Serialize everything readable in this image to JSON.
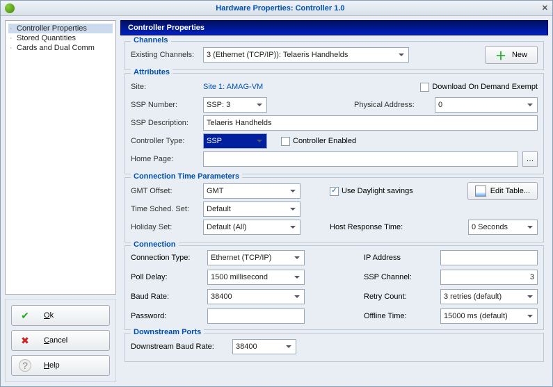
{
  "window_title": "Hardware Properties: Controller 1.0",
  "tree": {
    "items": [
      "Controller Properties",
      "Stored Quantities",
      "Cards and Dual Comm"
    ],
    "selected_index": 0
  },
  "buttons": {
    "ok": "Ok",
    "cancel": "Cancel",
    "help": "Help"
  },
  "header": "Controller Properties",
  "channels": {
    "legend": "Channels",
    "existing_label": "Existing Channels:",
    "existing_value": "3 (Ethernet (TCP/IP)): Telaeris Handhelds",
    "new_label": "New"
  },
  "attributes": {
    "legend": "Attributes",
    "site_label": "Site:",
    "site_value": "Site 1: AMAG-VM",
    "download_exempt_label": "Download On Demand Exempt",
    "download_exempt_checked": false,
    "ssp_number_label": "SSP Number:",
    "ssp_number_value": "SSP: 3",
    "physical_address_label": "Physical Address:",
    "physical_address_value": "0",
    "ssp_description_label": "SSP Description:",
    "ssp_description_value": "Telaeris Handhelds",
    "controller_type_label": "Controller Type:",
    "controller_type_value": "SSP",
    "controller_enabled_label": "Controller Enabled",
    "controller_enabled_checked": false,
    "home_page_label": "Home Page:",
    "home_page_value": ""
  },
  "conn_time": {
    "legend": "Connection Time Parameters",
    "gmt_offset_label": "GMT Offset:",
    "gmt_offset_value": "GMT",
    "daylight_label": "Use Daylight savings",
    "daylight_checked": true,
    "edit_table_label": "Edit Table...",
    "time_sched_label": "Time Sched. Set:",
    "time_sched_value": "Default",
    "holiday_label": "Holiday Set:",
    "holiday_value": "Default (All)",
    "host_response_label": "Host Response Time:",
    "host_response_value": "0 Seconds"
  },
  "connection": {
    "legend": "Connection",
    "type_label": "Connection Type:",
    "type_value": "Ethernet (TCP/IP)",
    "ip_label": "IP Address",
    "ip_value": "",
    "poll_label": "Poll Delay:",
    "poll_value": "1500 millisecond",
    "ssp_channel_label": "SSP Channel:",
    "ssp_channel_value": "3",
    "baud_label": "Baud Rate:",
    "baud_value": "38400",
    "retry_label": "Retry Count:",
    "retry_value": "3 retries (default)",
    "password_label": "Password:",
    "password_value": "",
    "offline_label": "Offline Time:",
    "offline_value": "15000 ms (default)"
  },
  "downstream": {
    "legend": "Downstream Ports",
    "baud_label": "Downstream Baud Rate:",
    "baud_value": "38400"
  }
}
